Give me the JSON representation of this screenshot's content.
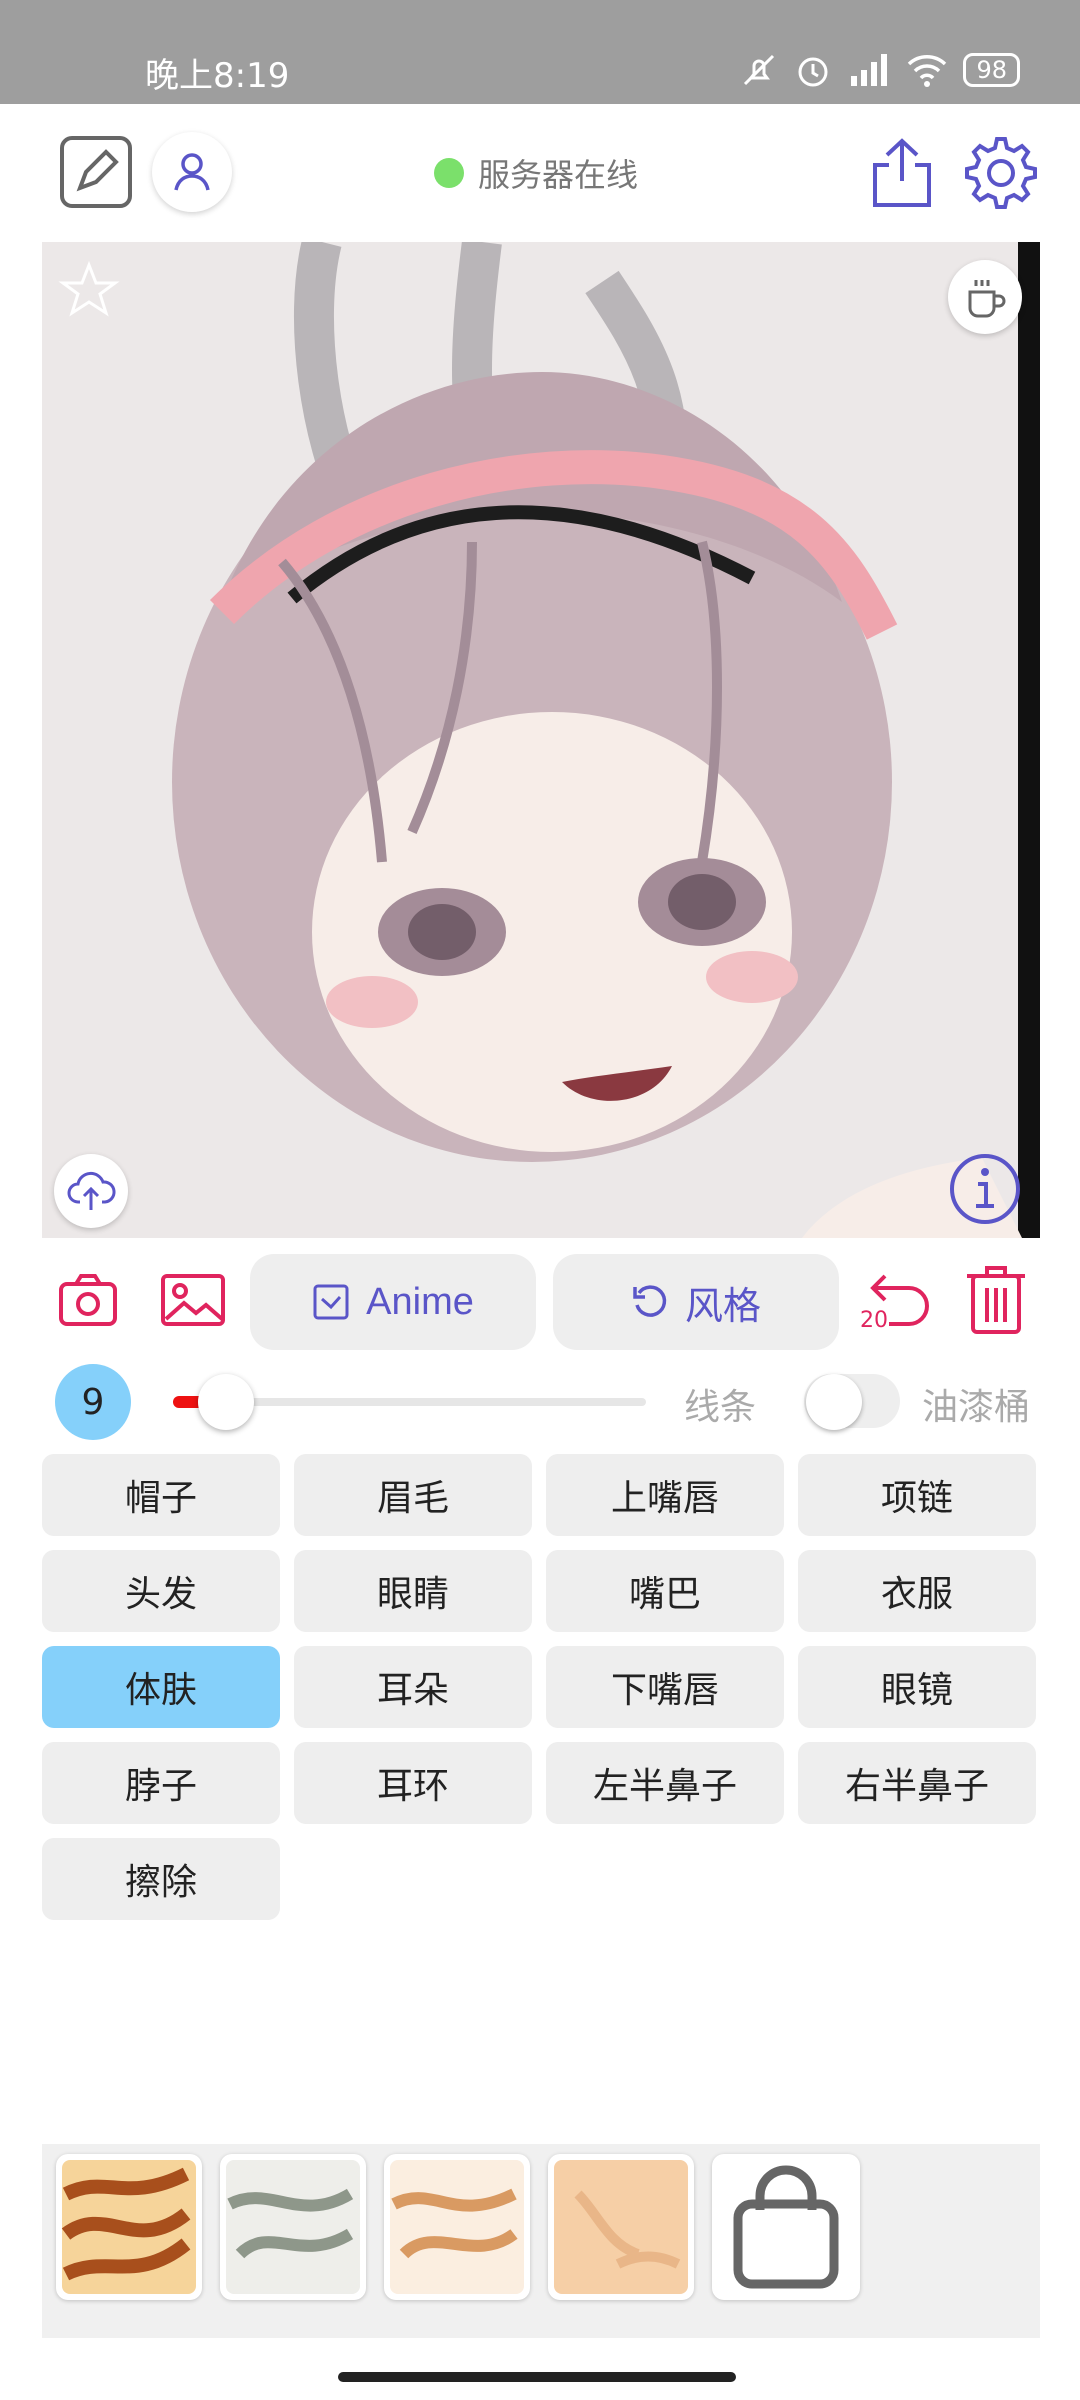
{
  "statusbar": {
    "time": "晚上8:19",
    "battery": "98"
  },
  "header": {
    "server_status": "服务器在线"
  },
  "tools": {
    "anime_label": "Anime",
    "style_label": "风格",
    "undo_count": "20"
  },
  "controls": {
    "brush_size": "9",
    "lines_label": "线条",
    "paint_bucket_label": "油漆桶"
  },
  "parts": [
    "帽子",
    "眉毛",
    "上嘴唇",
    "项链",
    "头发",
    "眼睛",
    "嘴巴",
    "衣服",
    "体肤",
    "耳朵",
    "下嘴唇",
    "眼镜",
    "脖子",
    "耳环",
    "左半鼻子",
    "右半鼻子",
    "擦除"
  ],
  "selected_part": "体肤",
  "colors": {
    "accent": "#5a55c8",
    "red": "#e0245e",
    "selected": "#85d0fa",
    "online": "#7be06b"
  }
}
